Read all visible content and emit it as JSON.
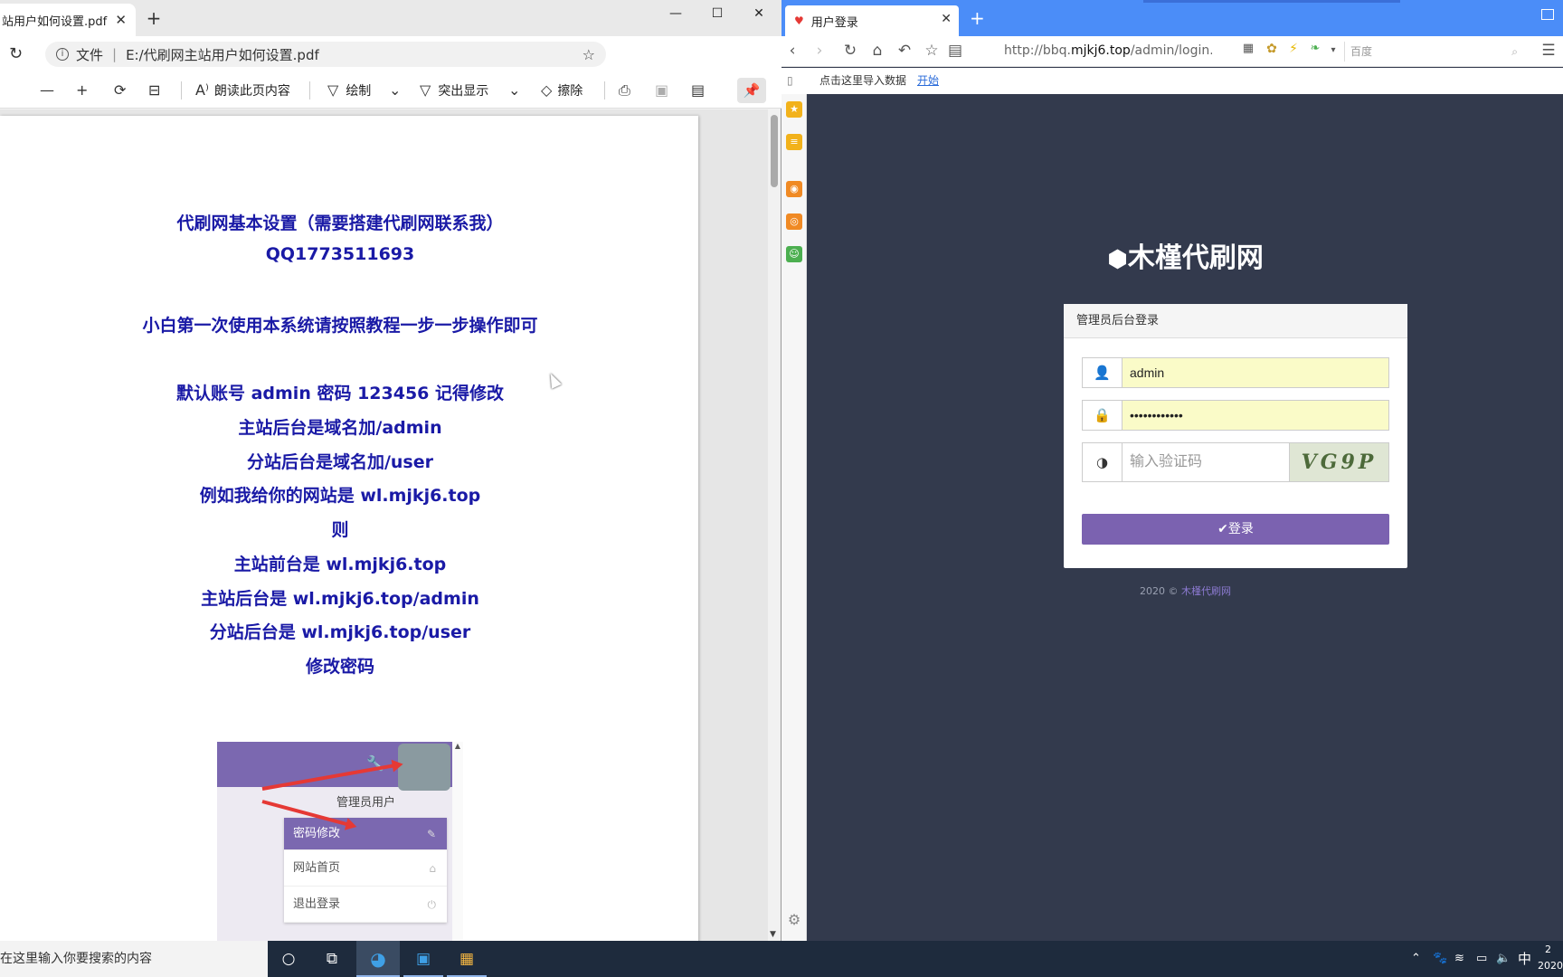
{
  "edge": {
    "tab_title": "站用户如何设置.pdf",
    "address_label": "文件",
    "address_path": "E:/代刷网主站用户如何设置.pdf",
    "toolbar": {
      "minus": "—",
      "plus": "+",
      "read_aloud": "朗读此页内容",
      "draw": "绘制",
      "highlight": "突出显示",
      "erase": "擦除"
    },
    "pdf_lines": [
      "代刷网基本设置（需要搭建代刷网联系我）",
      "QQ1773511693",
      "小白第一次使用本系统请按照教程一步一步操作即可",
      "默认账号 admin 密码 123456 记得修改",
      "主站后台是域名加/admin",
      "分站后台是域名加/user",
      "例如我给你的网站是 wl.mjkj6.top",
      "则",
      "主站前台是 wl.mjkj6.top",
      "主站后台是 wl.mjkj6.top/admin",
      "分站后台是 wl.mjkj6.top/user",
      "修改密码"
    ],
    "pdf_image": {
      "menu_title": "管理员用户",
      "items": [
        "密码修改",
        "网站首页",
        "退出登录"
      ]
    }
  },
  "browser": {
    "tab_title": "用户登录",
    "url_prefix": "http://bbq.",
    "url_domain": "mjkj6.top",
    "url_suffix": "/admin/login.php",
    "search_placeholder": "百度",
    "bookmark_hint": "点击这里导入数据",
    "bookmark_link": "开始",
    "page": {
      "brand": "木槿代刷网",
      "card_title": "管理员后台登录",
      "username_value": "admin",
      "password_value": "••••••••••••",
      "captcha_placeholder": "输入验证码",
      "captcha_text": "VG9P",
      "login_label": "✔登录",
      "footer_prefix": "2020 © ",
      "footer_link": "木槿代刷网"
    }
  },
  "taskbar": {
    "search_placeholder": "在这里输入你要搜索的内容",
    "tray_ime": "中",
    "tray_clock_top": "2",
    "tray_clock_bottom": "2020"
  },
  "colors": {
    "pdf_text": "#1a1aa6",
    "login_bg": "#333a4d",
    "accent_purple": "#7b62b0",
    "browser_tabbar": "#4b8df8",
    "taskbar": "#1e2b3d"
  }
}
